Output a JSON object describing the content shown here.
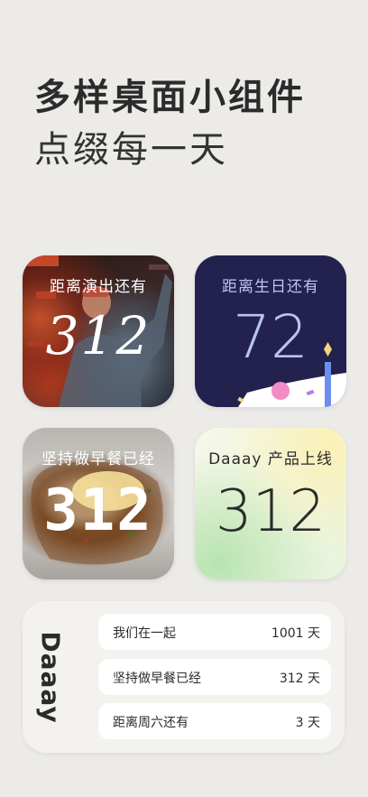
{
  "headline": {
    "line1": "多样桌面小组件",
    "line2": "点缀每一天"
  },
  "widgets": [
    {
      "title": "距离演出还有",
      "number": "312"
    },
    {
      "title": "距离生日还有",
      "number": "72"
    },
    {
      "title": "坚持做早餐已经",
      "number": "312"
    },
    {
      "title": "Daaay 产品上线",
      "number": "312"
    }
  ],
  "list_widget": {
    "brand": "Daaay",
    "rows": [
      {
        "label": "我们在一起",
        "value": "1001 天"
      },
      {
        "label": "坚持做早餐已经",
        "value": "312 天"
      },
      {
        "label": "距离周六还有",
        "value": "3 天"
      }
    ]
  },
  "colors": {
    "background": "#ecebe8",
    "birthday_bg": "#23214d",
    "birthday_text": "#b9c4ee"
  }
}
